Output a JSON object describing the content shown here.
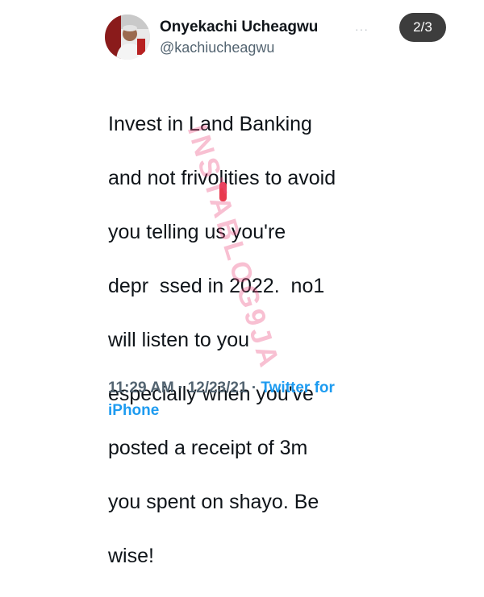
{
  "author": {
    "display_name": "Onyekachi Ucheagwu",
    "handle": "@kachiucheagwu"
  },
  "more_label": "···",
  "counter": "2/3",
  "tweet": {
    "lines": [
      "Invest in Land Banking",
      "and not frivolities to avoid",
      "you telling us you're",
      "depr  ssed in 2022.  no1",
      "will listen to you",
      "especially when you've",
      "posted a receipt of 3m",
      "you spent on shayo. Be",
      "wise!"
    ]
  },
  "watermark": "INSTABLOG9JA",
  "meta": {
    "time": "11:29 AM",
    "separator": "·",
    "date": "12/23/21",
    "source_line1": "Twitter for",
    "source_line2": "iPhone"
  },
  "colors": {
    "text": "#0f1419",
    "secondary": "#536471",
    "link": "#1d9bf0",
    "watermark": "#ec5082",
    "counter_bg": "#3d3d3d"
  }
}
